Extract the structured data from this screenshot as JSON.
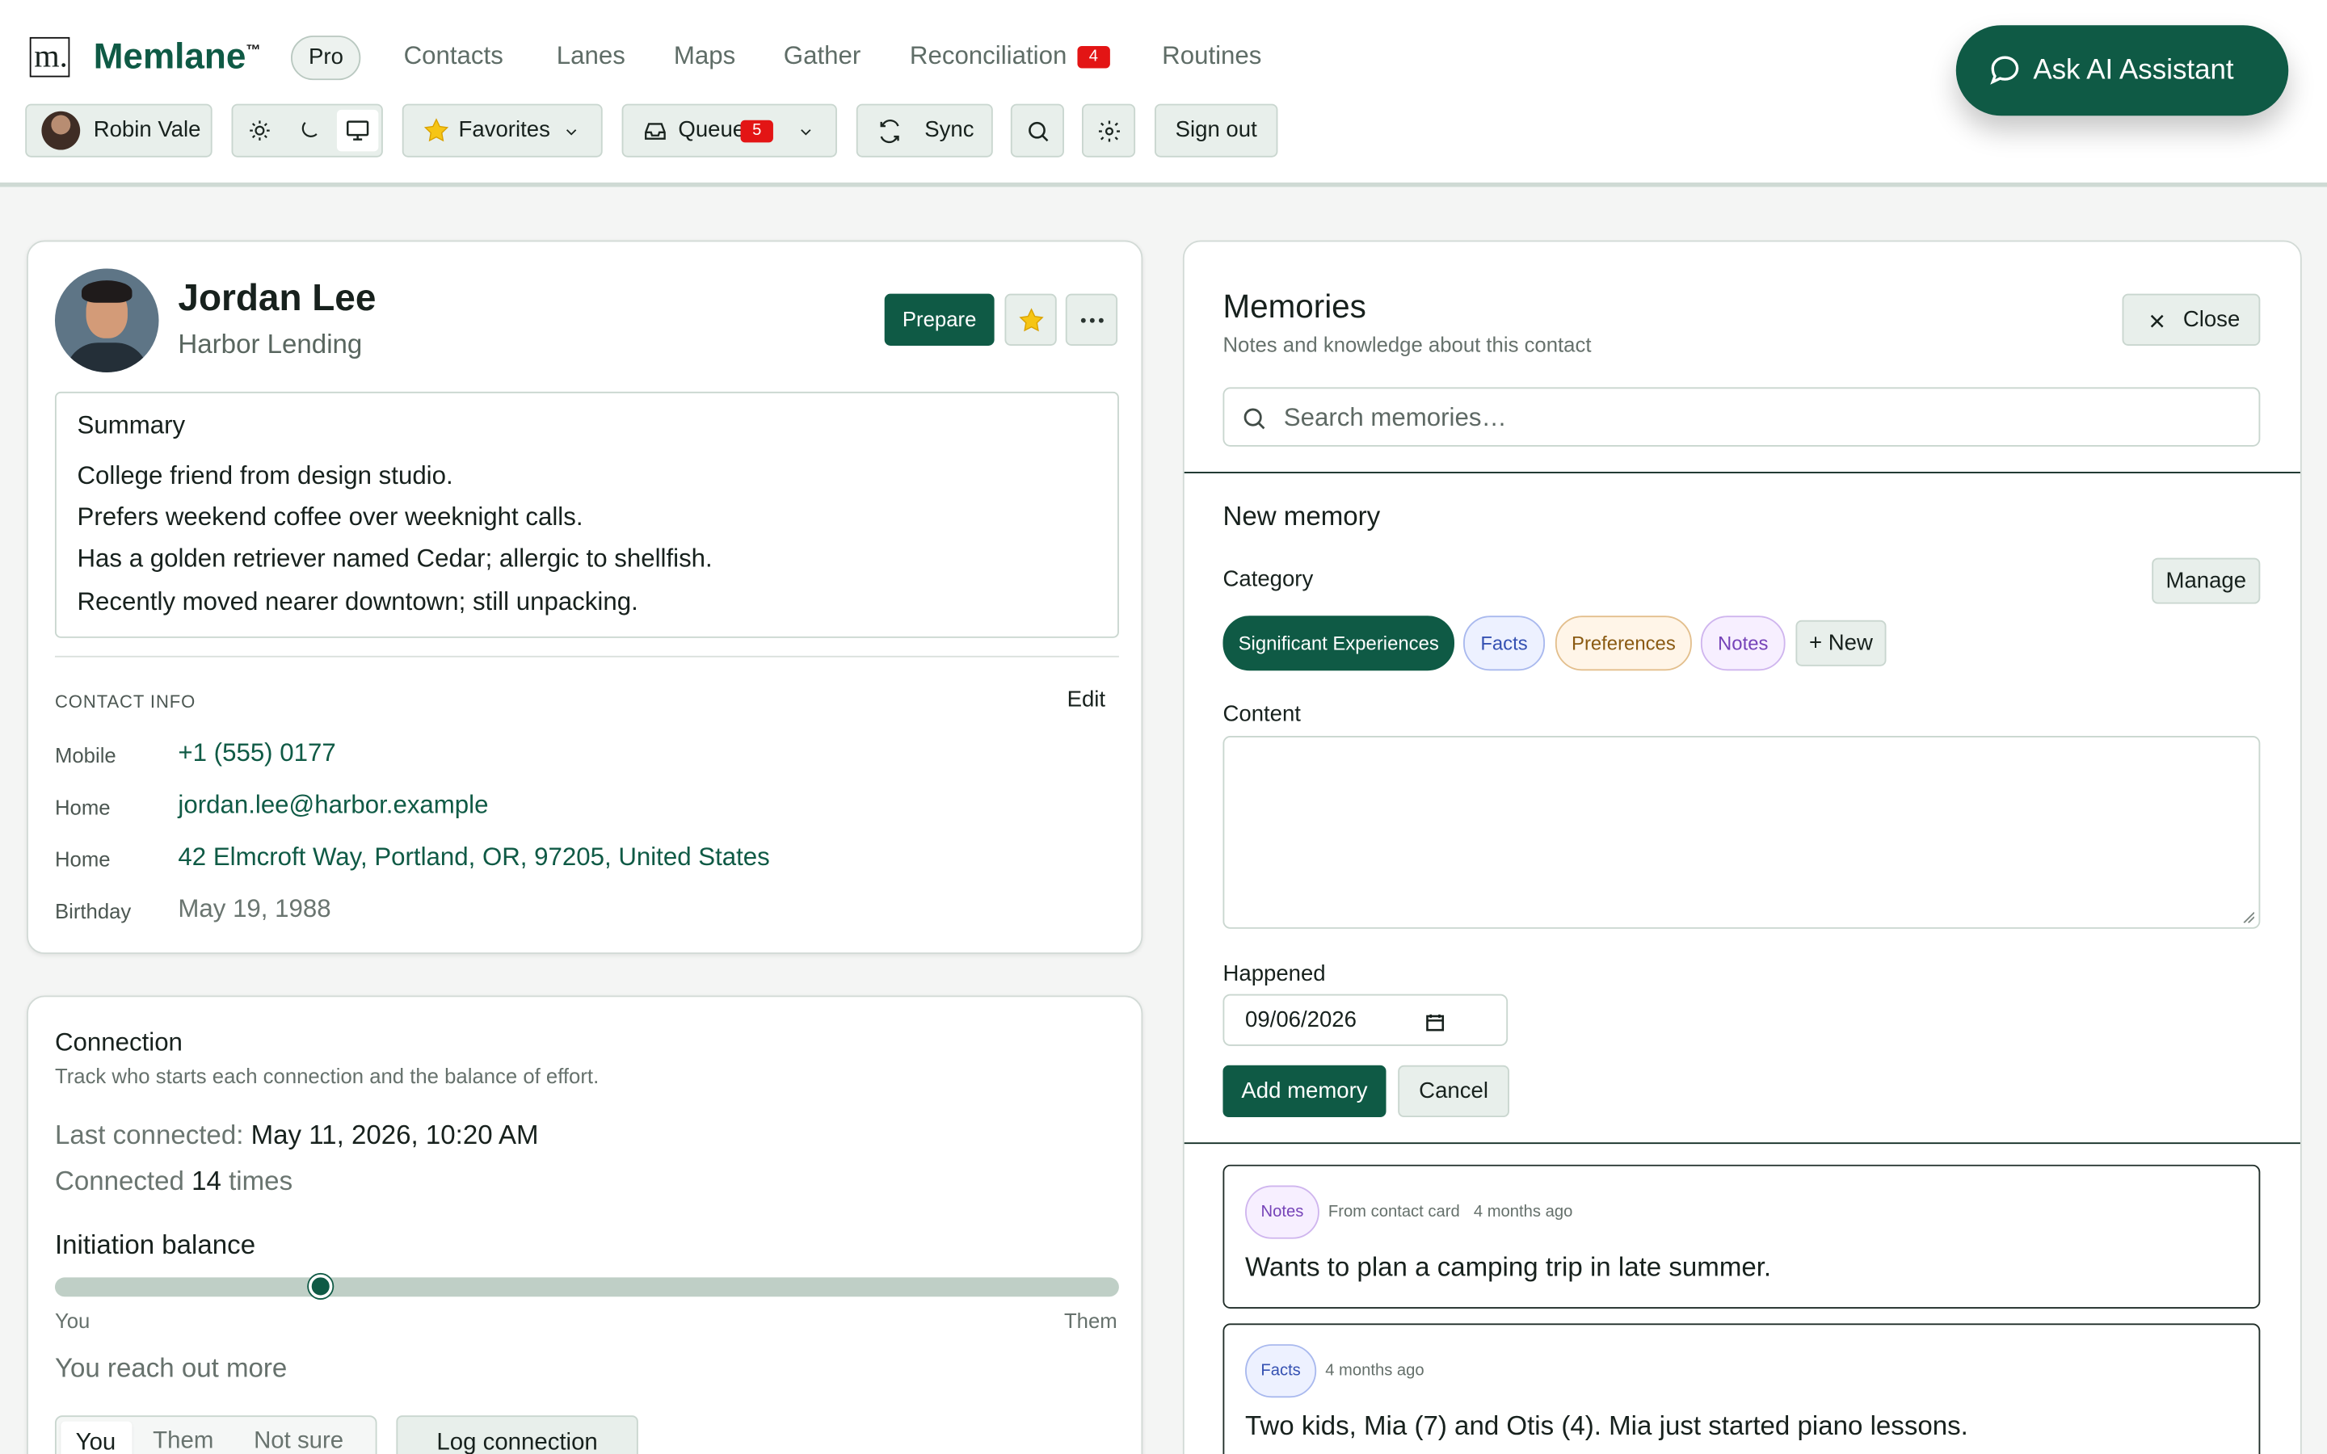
{
  "brand": {
    "logo_letter": "m.",
    "name": "Memlane",
    "tm": "™",
    "plan": "Pro"
  },
  "nav": [
    "Contacts",
    "Lanes",
    "Maps",
    "Gather",
    "Reconciliation",
    "Routines"
  ],
  "nav_badge": "4",
  "assistant": {
    "label": "Ask AI Assistant",
    "icon": "chat-bubble-icon"
  },
  "toolbar": {
    "user": "Robin Vale",
    "favorites": "Favorites",
    "queue": "Queue",
    "queue_count": "5",
    "sync": "Sync",
    "signout": "Sign out",
    "icons": [
      "sun-icon",
      "moon-icon",
      "monitor-icon",
      "star-icon",
      "inbox-icon",
      "refresh-icon",
      "search-icon",
      "gear-icon"
    ]
  },
  "contact": {
    "name": "Jordan Lee",
    "company": "Harbor Lending",
    "prepare": "Prepare",
    "summary_title": "Summary",
    "summary": [
      "College friend from design studio.",
      "Prefers weekend coffee over weeknight calls.",
      "Has a golden retriever named Cedar; allergic to shellfish.",
      "Recently moved nearer downtown; still unpacking."
    ],
    "contact_info_title": "CONTACT INFO",
    "edit": "Edit",
    "info": [
      {
        "label": "Mobile",
        "value": "+1 (555) 0177"
      },
      {
        "label": "Home",
        "value": "jordan.lee@harbor.example"
      },
      {
        "label": "Home",
        "value": "42 Elmcroft Way, Portland, OR, 97205, United States"
      },
      {
        "label": "Birthday",
        "value": "May 19, 1988"
      }
    ]
  },
  "connection": {
    "title": "Connection",
    "subtitle": "Track who starts each connection and the balance of effort.",
    "last_label": "Last connected:",
    "last_value": "May 11, 2026, 10:20 AM",
    "count_prefix": "Connected",
    "count": "14",
    "count_suffix": "times",
    "balance_title": "Initiation balance",
    "balance_fraction": 0.25,
    "left": "You",
    "right": "Them",
    "result": "You reach out more",
    "segments": [
      "You",
      "Them",
      "Not sure"
    ],
    "log": "Log connection"
  },
  "memories": {
    "title": "Memories",
    "subtitle": "Notes and knowledge about this contact",
    "close": "Close",
    "search_placeholder": "Search memories…",
    "new_title": "New memory",
    "category": "Category",
    "manage": "Manage",
    "categories": [
      "Significant Experiences",
      "Facts",
      "Preferences",
      "Notes"
    ],
    "new_category": "+ New",
    "content": "Content",
    "happened": "Happened",
    "date": "09/06/2026",
    "add": "Add memory",
    "cancel": "Cancel",
    "items": [
      {
        "tag": "Notes",
        "source": "From contact card",
        "time": "4 months ago",
        "text": "Wants to plan a camping trip in late summer."
      },
      {
        "tag": "Facts",
        "source": "",
        "time": "4 months ago",
        "text": "Two kids, Mia (7) and Otis (4). Mia just started piano lessons."
      }
    ]
  },
  "colors": {
    "primary": "#0f5a45",
    "badge": "#e31515",
    "border": "#c9d6cf"
  }
}
